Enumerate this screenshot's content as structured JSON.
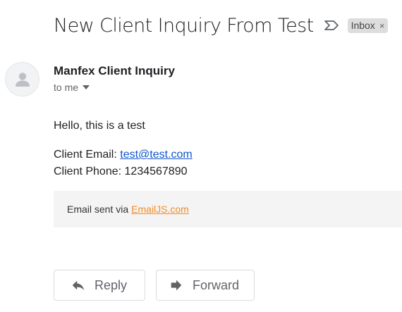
{
  "email": {
    "subject": "New Client Inquiry From Test",
    "label": "Inbox",
    "label_close": "×",
    "sender": "Manfex Client Inquiry",
    "recipient": "to me",
    "body": {
      "greeting": "Hello, this is a test",
      "email_label": "Client Email:",
      "email_value": "test@test.com",
      "phone_label": "Client Phone:",
      "phone_value": "1234567890"
    },
    "footer": {
      "text": "Email sent via",
      "link": "EmailJS.com"
    }
  },
  "actions": {
    "reply": "Reply",
    "forward": "Forward"
  },
  "icons": {
    "importance": "importance-marker-icon",
    "avatar": "person-icon",
    "recipient_details": "chevron-down-icon",
    "reply": "reply-arrow-icon",
    "forward": "forward-arrow-icon"
  },
  "colors": {
    "link": "#1155cc",
    "footer_link": "#f28c28",
    "chip_bg": "#dddddd",
    "footer_bg": "#f4f4f4"
  }
}
